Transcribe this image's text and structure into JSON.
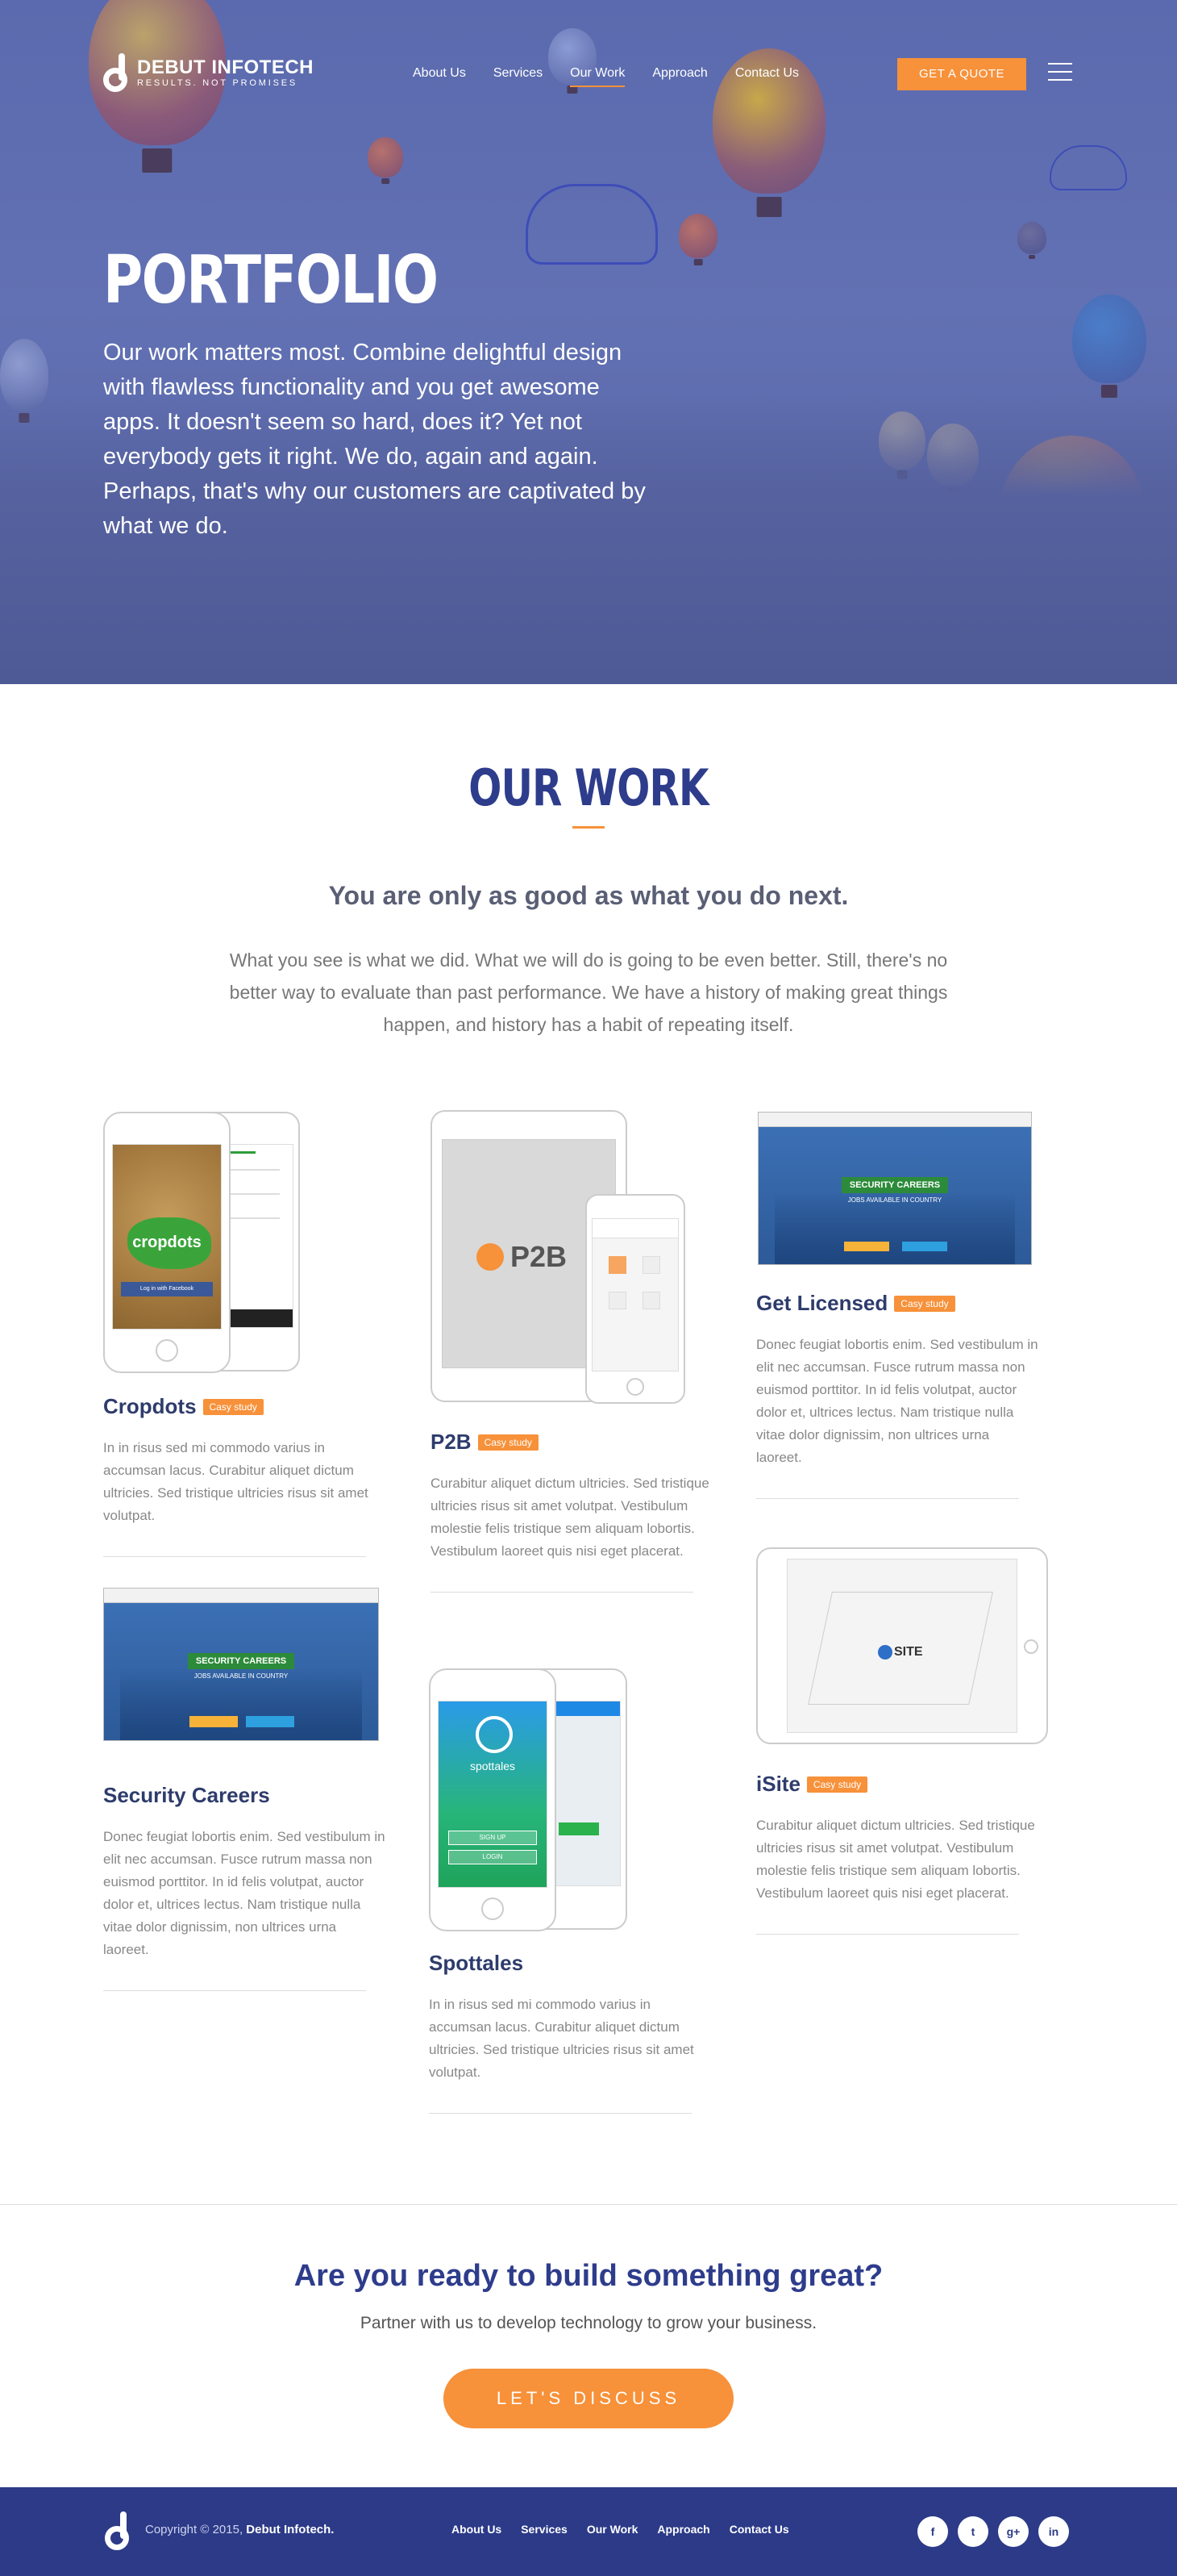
{
  "brand": {
    "name": "DEBUT INFOTECH",
    "tagline": "RESULTS. NOT PROMISES",
    "accent": "#f7913a",
    "primary": "#2e3c8c"
  },
  "nav": {
    "items": [
      {
        "label": "About Us"
      },
      {
        "label": "Services"
      },
      {
        "label": "Our Work",
        "active": true
      },
      {
        "label": "Approach"
      },
      {
        "label": "Contact Us"
      }
    ],
    "quote_label": "GET A QUOTE"
  },
  "hero": {
    "title": "PORTFOLIO",
    "text": "Our work matters most. Combine delightful design with flawless functionality and you get awesome apps. It doesn't seem so hard, does it? Yet not everybody gets it right. We do, again and again. Perhaps, that's why our customers are captivated by what we do."
  },
  "work": {
    "title": "OUR WORK",
    "subtitle": "You are only as good as what you do next.",
    "description": "What you see is what we did. What we will do is going to be even better. Still, there's no better way to evaluate than past performance. We have a history of making great things happen, and history has a habit of repeating itself.",
    "badge": "Casy study",
    "projects": [
      {
        "name": "Cropdots",
        "text": "In in risus sed mi commodo varius in accumsan lacus. Curabitur aliquet dictum ultricies. Sed tristique ultricies risus sit amet volutpat.",
        "screen_text": "cropdots",
        "login": "Log in with Facebook"
      },
      {
        "name": "P2B",
        "text": "Curabitur aliquet dictum ultricies. Sed tristique ultricies risus sit amet volutpat. Vestibulum molestie felis tristique sem aliquam lobortis. Vestibulum laoreet quis nisi eget placerat.",
        "screen_text": "P2B"
      },
      {
        "name": "Get Licensed",
        "text": "Donec feugiat lobortis enim. Sed vestibulum in elit nec accumsan. Fusce rutrum massa non euismod porttitor. In id felis volutpat, auctor dolor et, ultrices lectus. Nam tristique nulla vitae dolor dignissim, non ultrices urna laoreet.",
        "screen_text": "SECURITY CAREERS",
        "screen_sub": "JOBS AVAILABLE IN COUNTRY"
      },
      {
        "name": "Security Careers",
        "text": "Donec feugiat lobortis enim. Sed vestibulum in elit nec accumsan. Fusce rutrum massa non euismod porttitor. In id felis volutpat, auctor dolor et, ultrices lectus. Nam tristique nulla vitae dolor dignissim, non ultrices urna laoreet.",
        "screen_text": "SECURITY CAREERS",
        "screen_sub": "JOBS AVAILABLE IN COUNTRY"
      },
      {
        "name": "Spottales",
        "text": "In in risus sed mi commodo varius in accumsan lacus. Curabitur aliquet dictum ultricies. Sed tristique ultricies risus sit amet volutpat.",
        "screen_text": "spottales",
        "signup": "SIGN UP",
        "login": "LOGIN"
      },
      {
        "name": "iSite",
        "text": "Curabitur aliquet dictum ultricies. Sed tristique ultricies risus sit amet volutpat. Vestibulum molestie felis tristique sem aliquam lobortis. Vestibulum laoreet quis nisi eget placerat.",
        "screen_text": "SITE"
      }
    ]
  },
  "cta": {
    "title": "Are you ready to build something great?",
    "subtitle": "Partner with us to develop technology to grow your business.",
    "button": "LET'S DISCUSS"
  },
  "footer": {
    "copyright_prefix": "Copyright © 2015,",
    "copyright_brand": "Debut Infotech.",
    "menu": [
      "About Us",
      "Services",
      "Our Work",
      "Approach",
      "Contact Us"
    ],
    "social": [
      {
        "icon": "facebook-icon",
        "glyph": "f"
      },
      {
        "icon": "twitter-icon",
        "glyph": "t"
      },
      {
        "icon": "google-plus-icon",
        "glyph": "g+"
      },
      {
        "icon": "linkedin-icon",
        "glyph": "in"
      }
    ]
  }
}
